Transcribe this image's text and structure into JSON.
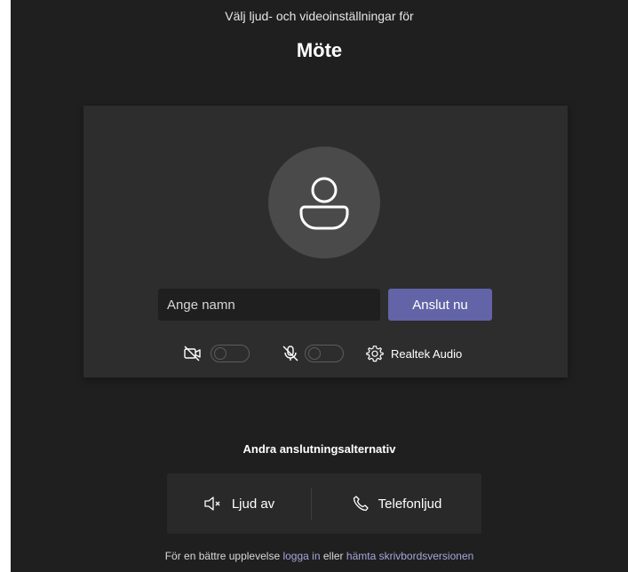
{
  "header": {
    "subtitle": "Välj ljud- och videoinställningar för",
    "title": "Möte"
  },
  "prejoin": {
    "name_placeholder": "Ange namn",
    "join_label": "Anslut nu",
    "camera": {
      "icon": "camera-off-icon",
      "on": false
    },
    "microphone": {
      "icon": "mic-off-icon",
      "on": false
    },
    "device_label": "Realtek Audio"
  },
  "other_options": {
    "title": "Andra anslutningsalternativ",
    "audio_off_label": "Ljud av",
    "phone_audio_label": "Telefonljud"
  },
  "footer": {
    "prefix": "För en bättre upplevelse",
    "login_link": "logga in",
    "middle": "eller",
    "desktop_link": "hämta skrivbordsversionen"
  },
  "colors": {
    "background": "#1f1f1f",
    "card": "#2d2d2d",
    "accent": "#6264a7",
    "link": "#a6a7dc"
  }
}
